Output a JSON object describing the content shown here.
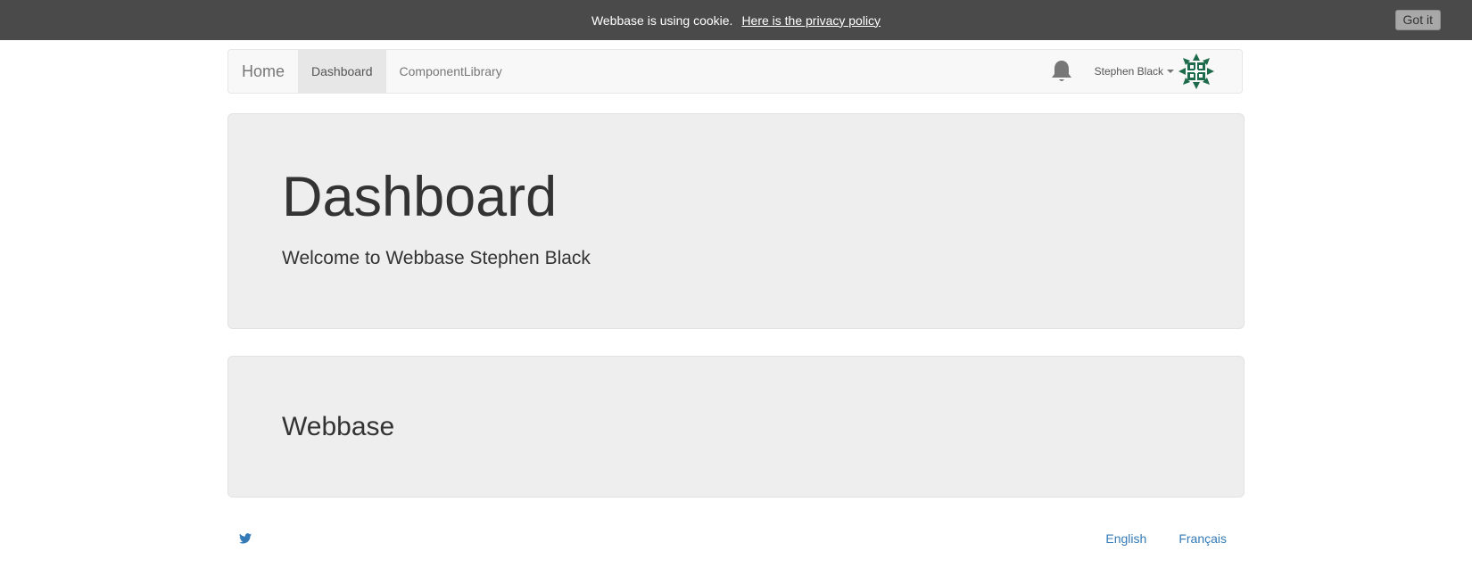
{
  "cookie_bar": {
    "message": "Webbase is using cookie.",
    "policy_link": "Here is the privacy policy",
    "accept_button": "Got it"
  },
  "navbar": {
    "brand": "Home",
    "items": [
      {
        "label": "Dashboard",
        "active": true
      },
      {
        "label": "ComponentLibrary",
        "active": false
      }
    ],
    "notifications_icon": "bell-icon",
    "user": {
      "name": "Stephen Black",
      "avatar_icon": "identicon-avatar"
    }
  },
  "main": {
    "title": "Dashboard",
    "welcome": "Welcome to Webbase Stephen Black",
    "section_title": "Webbase"
  },
  "footer": {
    "social_icon": "twitter-icon",
    "languages": [
      "English",
      "Français"
    ]
  },
  "colors": {
    "cookie_bar_bg": "#4a4a4a",
    "navbar_bg": "#f8f8f8",
    "jumbotron_bg": "#eeeeee",
    "link": "#337ab7",
    "avatar": "#1d6b4a"
  }
}
